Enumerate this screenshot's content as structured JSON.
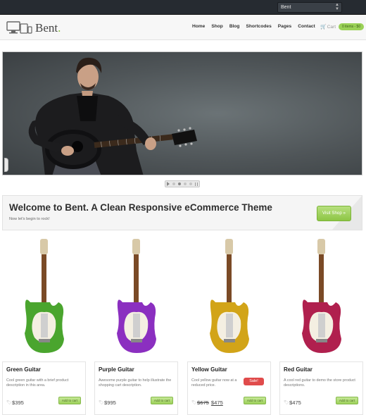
{
  "topbar": {
    "theme_select_value": "Bent"
  },
  "header": {
    "logo_text": "Bent",
    "logo_dot": ".",
    "nav": [
      "Home",
      "Shop",
      "Blog",
      "Shortcodes",
      "Pages",
      "Contact"
    ],
    "cart_label": "Cart",
    "cart_badge": "0 items - $0"
  },
  "welcome": {
    "title": "Welcome to Bent. A Clean Responsive eCommerce Theme",
    "subtitle": "Now let's begin to rock!",
    "button": "Visit Shop »"
  },
  "products": [
    {
      "name": "Green Guitar",
      "description": "Cool green guitar with a brief product description in this area.",
      "price": "$395",
      "add_label": "Add to cart",
      "color": "#4aa52e"
    },
    {
      "name": "Purple Guitar",
      "description": "Awesome purple guitar to help illustrate the shopping cart description.",
      "price": "$995",
      "add_label": "Add to cart",
      "color": "#8b2fc0"
    },
    {
      "name": "Yellow Guitar",
      "description": "Cool yellow guitar now at a reduced price.",
      "sale_label": "Sale!",
      "old_price": "$675",
      "new_price": "$475",
      "add_label": "Add to cart",
      "color": "#d2a418"
    },
    {
      "name": "Red Guitar",
      "description": "A cool red guitar to demo the store product descriptions.",
      "price": "$475",
      "add_label": "Add to cart",
      "color": "#b0204e"
    }
  ]
}
